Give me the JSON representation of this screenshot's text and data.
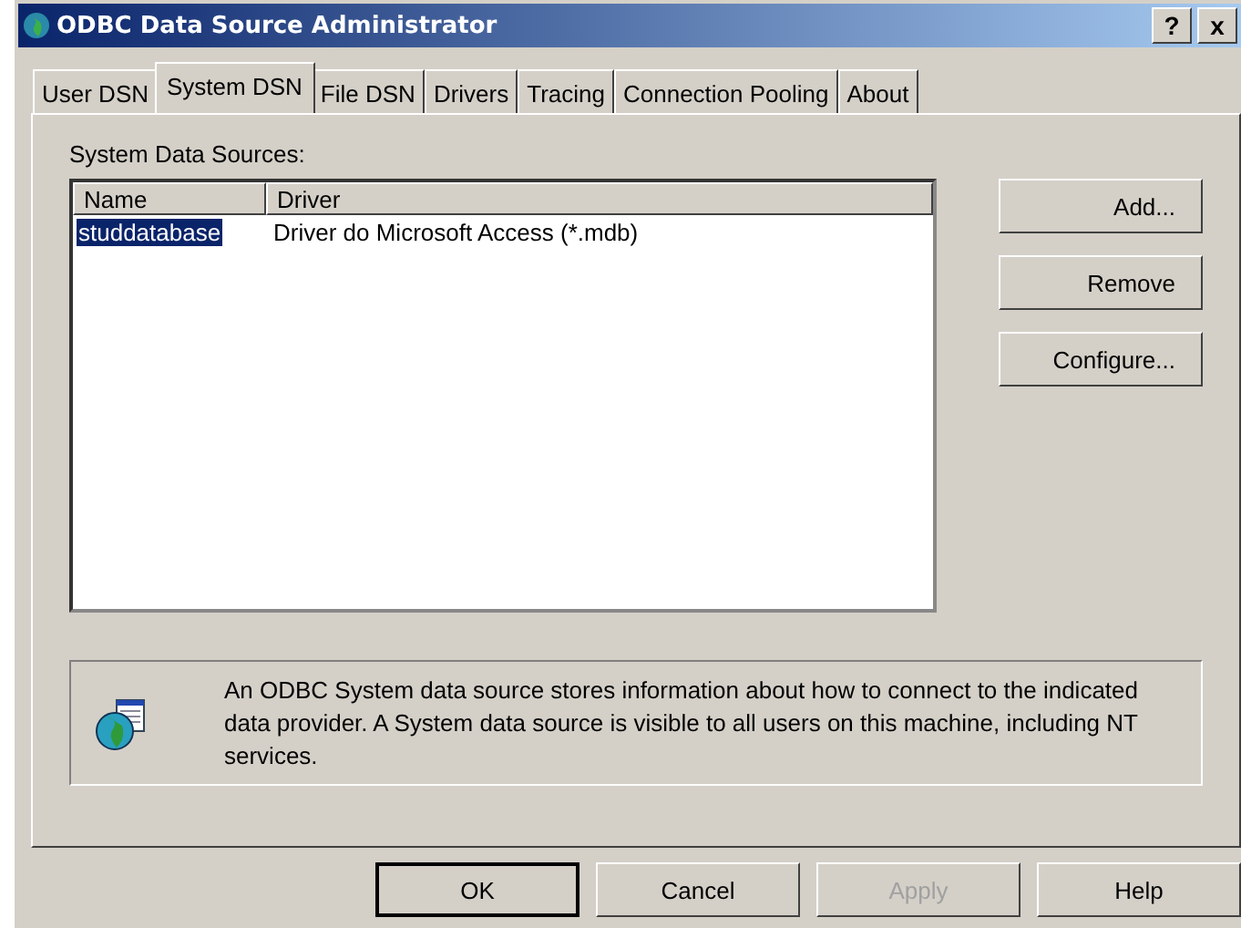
{
  "window": {
    "title": "ODBC Data Source Administrator",
    "help_button": "?",
    "close_button": "x"
  },
  "tabs": [
    {
      "label": "User DSN",
      "selected": false
    },
    {
      "label": "System DSN",
      "selected": true
    },
    {
      "label": "File DSN",
      "selected": false
    },
    {
      "label": "Drivers",
      "selected": false
    },
    {
      "label": "Tracing",
      "selected": false
    },
    {
      "label": "Connection Pooling",
      "selected": false
    },
    {
      "label": "About",
      "selected": false
    }
  ],
  "list_label": "System Data Sources:",
  "table": {
    "columns": [
      "Name",
      "Driver"
    ],
    "rows": [
      {
        "cells": [
          "studdatabase",
          "Driver do Microsoft Access (*.mdb)"
        ],
        "selected": true
      }
    ]
  },
  "side_buttons": [
    "Add...",
    "Remove",
    "Configure..."
  ],
  "info": "An ODBC System data source stores information about how to connect to the indicated data provider.   A System data source is visible to all users on this machine, including NT services.",
  "buttons": [
    {
      "label": "OK",
      "disabled": false,
      "default": true
    },
    {
      "label": "Cancel",
      "disabled": false,
      "default": false
    },
    {
      "label": "Apply",
      "disabled": true,
      "default": false
    },
    {
      "label": "Help",
      "disabled": false,
      "default": false
    }
  ]
}
